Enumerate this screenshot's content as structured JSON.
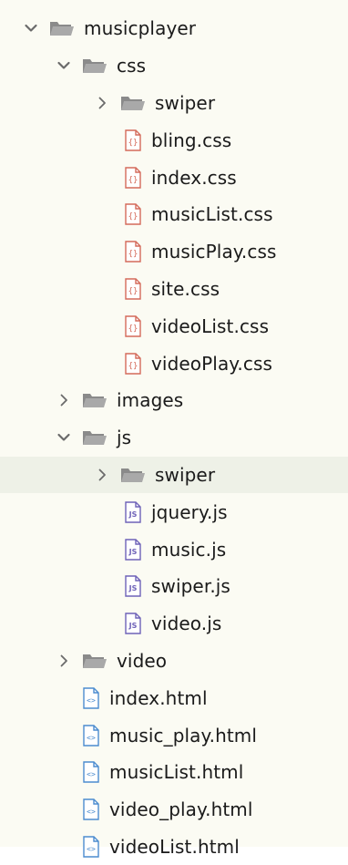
{
  "colors": {
    "panel_bg": "#fbfbf3",
    "selected_bg": "#eef1e7",
    "folder": "#8a8a8a",
    "css_icon": "#d46a5a",
    "js_icon": "#6e62b8",
    "html_icon": "#4c8ccf",
    "chevron": "#6a6a6a"
  },
  "tree": [
    {
      "label": "musicplayer",
      "type": "folder",
      "expanded": true,
      "depth": 0
    },
    {
      "label": "css",
      "type": "folder",
      "expanded": true,
      "depth": 1
    },
    {
      "label": "swiper",
      "type": "folder",
      "expanded": false,
      "depth": 2
    },
    {
      "label": "bling.css",
      "type": "css",
      "depth": 2
    },
    {
      "label": "index.css",
      "type": "css",
      "depth": 2
    },
    {
      "label": "musicList.css",
      "type": "css",
      "depth": 2
    },
    {
      "label": "musicPlay.css",
      "type": "css",
      "depth": 2
    },
    {
      "label": "site.css",
      "type": "css",
      "depth": 2
    },
    {
      "label": "videoList.css",
      "type": "css",
      "depth": 2
    },
    {
      "label": "videoPlay.css",
      "type": "css",
      "depth": 2
    },
    {
      "label": "images",
      "type": "folder",
      "expanded": false,
      "depth": 1
    },
    {
      "label": "js",
      "type": "folder",
      "expanded": true,
      "depth": 1
    },
    {
      "label": "swiper",
      "type": "folder",
      "expanded": false,
      "depth": 2,
      "selected": true
    },
    {
      "label": "jquery.js",
      "type": "js",
      "depth": 2
    },
    {
      "label": "music.js",
      "type": "js",
      "depth": 2
    },
    {
      "label": "swiper.js",
      "type": "js",
      "depth": 2
    },
    {
      "label": "video.js",
      "type": "js",
      "depth": 2
    },
    {
      "label": "video",
      "type": "folder",
      "expanded": false,
      "depth": 1
    },
    {
      "label": "index.html",
      "type": "html",
      "depth": 1
    },
    {
      "label": "music_play.html",
      "type": "html",
      "depth": 1
    },
    {
      "label": "musicList.html",
      "type": "html",
      "depth": 1
    },
    {
      "label": "video_play.html",
      "type": "html",
      "depth": 1
    },
    {
      "label": "videoList.html",
      "type": "html",
      "depth": 1
    }
  ]
}
